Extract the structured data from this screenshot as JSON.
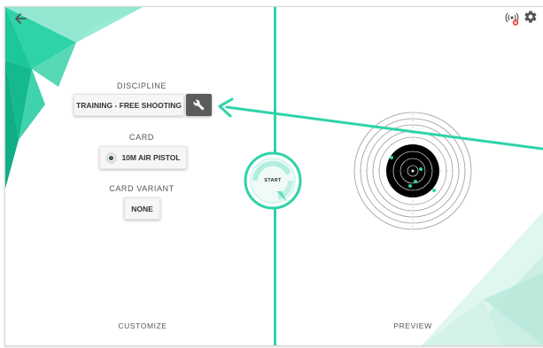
{
  "left_panel": {
    "discipline_label": "DISCIPLINE",
    "discipline_value": "TRAINING - FREE SHOOTING",
    "card_label": "CARD",
    "card_value": "10M AIR PISTOL",
    "card_variant_label": "CARD VARIANT",
    "card_variant_value": "NONE",
    "footer_label": "CUSTOMIZE"
  },
  "right_panel": {
    "footer_label": "PREVIEW"
  },
  "start_button": {
    "label": "START"
  },
  "icons": {
    "back": "arrow-left-icon",
    "connection": "broadcast-disconnected-icon",
    "settings": "gear-icon",
    "wrench": "wrench-icon",
    "target_card": "target-card-icon"
  },
  "colors": {
    "accent": "#2ed3a8",
    "accent_light": "#7fe3c9",
    "button_dark": "#5b5b5b",
    "target_black": "#000000",
    "disconnected_badge": "#e53935"
  }
}
